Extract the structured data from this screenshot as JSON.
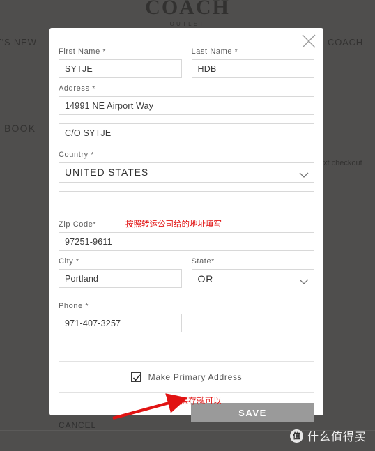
{
  "background": {
    "logo_wordmark": "COACH",
    "logo_sub": "OUTLET",
    "nav_left": "T'S NEW",
    "nav_right": "COACH",
    "book_text": "BOOK",
    "checkout_text": "xt checkout"
  },
  "watermark": {
    "badge": "值",
    "text": "什么值得买"
  },
  "modal": {
    "close_icon": "close-icon",
    "fields": {
      "first_name": {
        "label": "First Name",
        "required": "*",
        "value": "SYTJE"
      },
      "last_name": {
        "label": "Last Name",
        "required": "*",
        "value": "HDB"
      },
      "address": {
        "label": "Address",
        "required": "*",
        "value": "14991 NE Airport Way"
      },
      "address2": {
        "label": "",
        "value": "C/O SYTJE"
      },
      "country": {
        "label": "Country",
        "required": "*",
        "value": "UNITED STATES"
      },
      "country2": {
        "label": "",
        "value": ""
      },
      "zip": {
        "label": "Zip Code",
        "required": "*",
        "value": "97251-9611"
      },
      "city": {
        "label": "City",
        "required": "*",
        "value": "Portland"
      },
      "state": {
        "label": "State",
        "required": "*",
        "value": "OR"
      },
      "phone": {
        "label": "Phone",
        "required": "*",
        "value": "971-407-3257"
      }
    },
    "primary_address": {
      "label": "Make Primary Address",
      "checked": true
    },
    "cancel_label": "CANCEL",
    "save_label": "SAVE"
  },
  "annotations": {
    "zip_note": "按照转运公司给的地址填写",
    "save_note": "保存就可以",
    "arrow_color": "#e11313"
  },
  "colors": {
    "scrim": "#373634",
    "save_button": "#9a9a9a",
    "annotation_red": "#e11313",
    "input_border": "#d8d8d8"
  }
}
